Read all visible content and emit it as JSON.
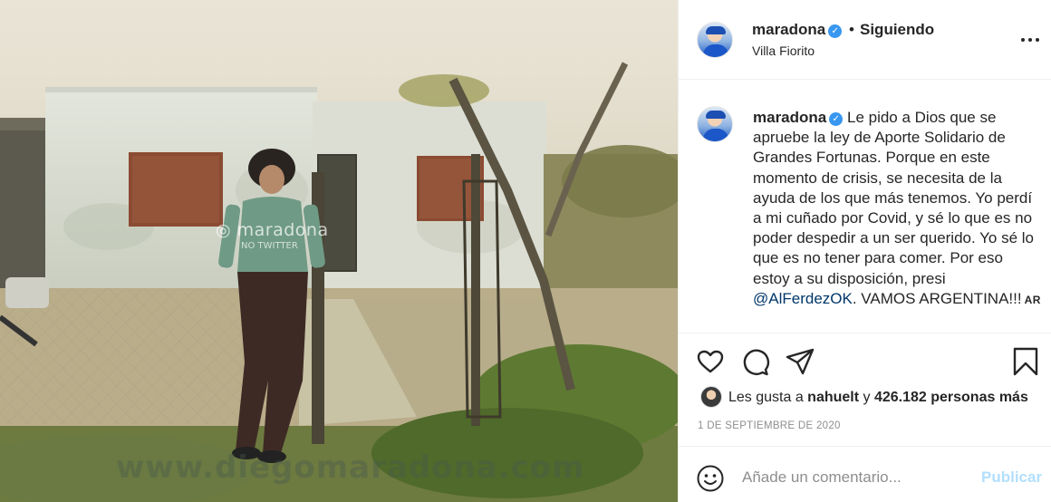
{
  "post": {
    "photo_alt": "Photo of a young man standing in front of a whitewashed house",
    "watermark_handle": "maradona",
    "watermark_note": "NO TWITTER",
    "watermark_site": "www.diegomaradona.com"
  },
  "header": {
    "username": "maradona",
    "verified_mark": "✓",
    "separator": "•",
    "follow_status": "Siguiendo",
    "location": "Villa Fiorito",
    "more_icon": "more-horizontal-icon"
  },
  "caption": {
    "username": "maradona",
    "text_before": "Le pido a Dios que se apruebe la ley de Aporte Solidario de Grandes Fortunas. Porque en este momento de crisis, se necesita de la ayuda de los que más tenemos. Yo perdí a mi cuñado por Covid, y sé lo que es no poder despedir a un ser querido. Yo sé lo que es no tener para comer. Por eso estoy a su disposición, presi ",
    "mention": "@AlFerdezOK",
    "text_after": ". VAMOS ARGENTINA!!!",
    "translate_label": "AR"
  },
  "actions": {
    "icons": [
      "heart-icon",
      "comment-icon",
      "share-icon",
      "bookmark-icon"
    ]
  },
  "likes": {
    "prefix": "Les gusta a ",
    "user": "nahuelt",
    "middle": " y ",
    "count": "426.182 personas más"
  },
  "date": "1 DE SEPTIEMBRE DE 2020",
  "comment_box": {
    "placeholder": "Añade un comentario...",
    "publish_label": "Publicar"
  },
  "colors": {
    "link": "#00376b",
    "verified": "#3897f0",
    "publish_disabled": "#b2dffc",
    "muted": "#8e8e8e"
  }
}
